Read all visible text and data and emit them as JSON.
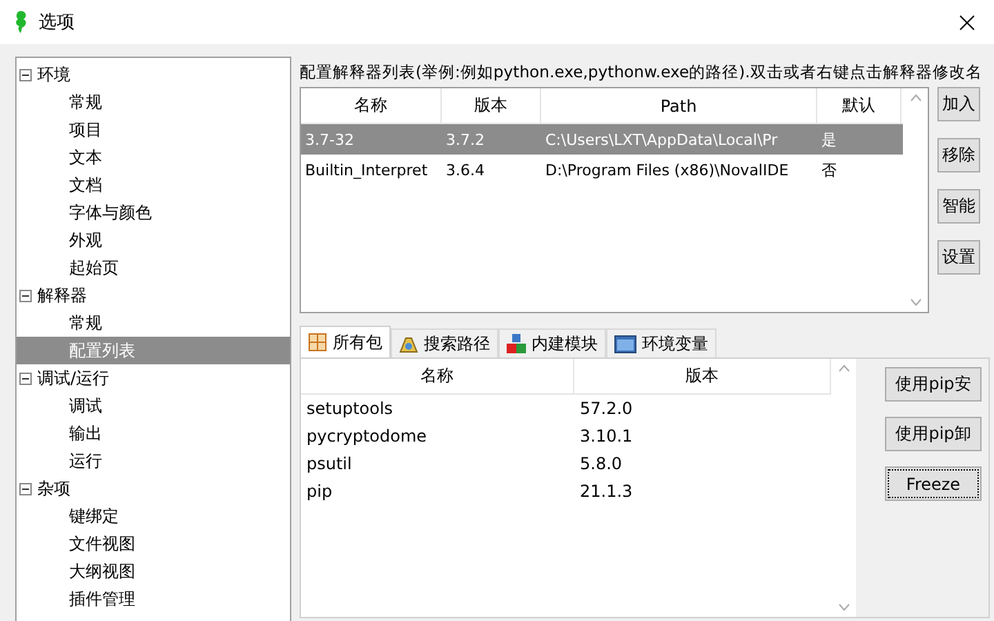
{
  "window": {
    "title": "选项"
  },
  "tree": [
    {
      "label": "环境",
      "expanded": true,
      "children": [
        {
          "label": "常规",
          "selected": false
        },
        {
          "label": "项目",
          "selected": false
        },
        {
          "label": "文本",
          "selected": false
        },
        {
          "label": "文档",
          "selected": false
        },
        {
          "label": "字体与颜色",
          "selected": false
        },
        {
          "label": "外观",
          "selected": false
        },
        {
          "label": "起始页",
          "selected": false
        }
      ]
    },
    {
      "label": "解释器",
      "expanded": true,
      "children": [
        {
          "label": "常规",
          "selected": false
        },
        {
          "label": "配置列表",
          "selected": true
        }
      ]
    },
    {
      "label": "调试/运行",
      "expanded": true,
      "children": [
        {
          "label": "调试",
          "selected": false
        },
        {
          "label": "输出",
          "selected": false
        },
        {
          "label": "运行",
          "selected": false
        }
      ]
    },
    {
      "label": "杂项",
      "expanded": true,
      "children": [
        {
          "label": "键绑定",
          "selected": false
        },
        {
          "label": "文件视图",
          "selected": false
        },
        {
          "label": "大纲视图",
          "selected": false
        },
        {
          "label": "插件管理",
          "selected": false
        }
      ]
    }
  ],
  "caption": "配置解释器列表(举例:例如python.exe,pythonw.exe的路径).双击或者右键点击解释器修改名",
  "interpreters": {
    "columns": [
      "名称",
      "版本",
      "Path",
      "默认"
    ],
    "rows": [
      {
        "cells": [
          "3.7-32",
          "3.7.2",
          "C:\\Users\\LXT\\AppData\\Local\\Pr",
          "是"
        ],
        "selected": true
      },
      {
        "cells": [
          "Builtin_Interpret",
          "3.6.4",
          "D:\\Program Files (x86)\\NovalIDE",
          "否"
        ],
        "selected": false
      }
    ]
  },
  "interpreter_buttons": [
    "加入",
    "移除",
    "智能",
    "设置"
  ],
  "tabs": [
    {
      "label": "所有包",
      "kind": "packages",
      "selected": true
    },
    {
      "label": "搜索路径",
      "kind": "paths",
      "selected": false
    },
    {
      "label": "内建模块",
      "kind": "modules",
      "selected": false
    },
    {
      "label": "环境变量",
      "kind": "env",
      "selected": false
    }
  ],
  "packages": {
    "columns": [
      "名称",
      "版本"
    ],
    "rows": [
      [
        "setuptools",
        "57.2.0"
      ],
      [
        "pycryptodome",
        "3.10.1"
      ],
      [
        "psutil",
        "5.8.0"
      ],
      [
        "pip",
        "21.1.3"
      ]
    ]
  },
  "package_buttons": [
    {
      "label": "使用pip安",
      "focused": false
    },
    {
      "label": "使用pip卸",
      "focused": false
    },
    {
      "label": "Freeze",
      "focused": true
    }
  ]
}
